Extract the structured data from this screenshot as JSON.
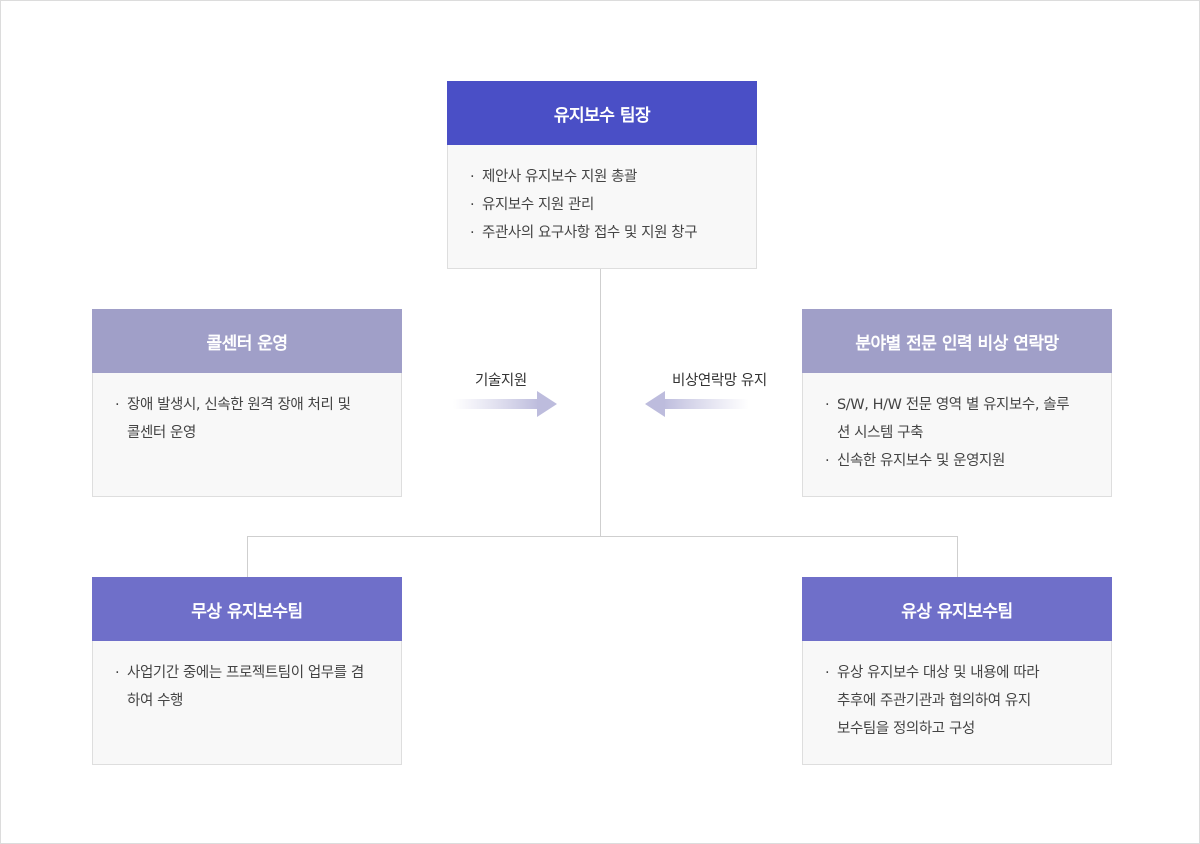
{
  "leader": {
    "title": "유지보수 팀장",
    "items": [
      "제안사 유지보수 지원 총괄",
      "유지보수 지원 관리",
      "주관사의 요구사항 접수 및 지원 창구"
    ]
  },
  "call_center": {
    "title": "콜센터 운영",
    "items": [
      "장애 발생시, 신속한 원격 장애 처리 및 콜센터 운영"
    ]
  },
  "expert": {
    "title": "분야별 전문 인력 비상 연락망",
    "items": [
      "S/W, H/W 전문 영역 별 유지보수, 솔루션 시스템 구축",
      "신속한 유지보수 및 운영지원"
    ]
  },
  "free_team": {
    "title": "무상 유지보수팀",
    "items": [
      "사업기간 중에는 프로젝트팀이 업무를 겸하여 수행"
    ]
  },
  "paid_team": {
    "title": "유상 유지보수팀",
    "items": [
      "유상 유지보수 대상 및 내용에 따라 추후에 주관기관과 협의하여 유지 보수팀을 정의하고 구성"
    ]
  },
  "arrows": {
    "left_label": "기술지원",
    "right_label": "비상연락망 유지"
  },
  "colors": {
    "leader_header": "#4a4fc6",
    "side_header": "#a09fc8",
    "team_header": "#6f6fc9"
  }
}
